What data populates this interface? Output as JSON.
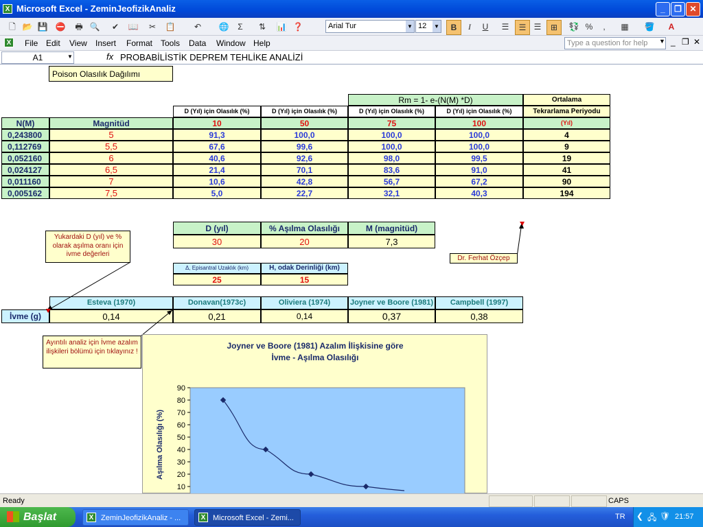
{
  "window": {
    "title": "Microsoft Excel - ZeminJeofizikAnaliz"
  },
  "toolbar": {
    "font": "Arial Tur",
    "font_size": "12"
  },
  "menu": [
    "File",
    "Edit",
    "View",
    "Insert",
    "Format",
    "Tools",
    "Data",
    "Window",
    "Help"
  ],
  "help_placeholder": "Type a question for help",
  "formula_bar": {
    "cell": "A1",
    "fx": "fx",
    "content": "PROBABİLİSTİK DEPREM TEHLİKE ANALİZİ"
  },
  "sheet": {
    "poisson_label": "Poison Olasılık Dağılımı",
    "formula_label": "Rm = 1- e-(N(M) *D)",
    "ortalama_label": "Ortalama",
    "tekrar_label": "Tekrarlama Periyodu",
    "col_headers": [
      "D (Yıl) için Olasılık (%)",
      "D (Yıl) için Olasılık (%)",
      "D (Yıl) için Olasılık (%)",
      "D (Yıl) için Olasılık (%)"
    ],
    "nm_label": "N(M)",
    "mag_label": "Magnitüd",
    "years": [
      "10",
      "50",
      "75",
      "100"
    ],
    "yil_label": "(Yıl)",
    "rows": [
      {
        "nm": "0,243800",
        "mag": "5",
        "p": [
          "91,3",
          "100,0",
          "100,0",
          "100,0"
        ],
        "period": "4"
      },
      {
        "nm": "0,112769",
        "mag": "5,5",
        "p": [
          "67,6",
          "99,6",
          "100,0",
          "100,0"
        ],
        "period": "9"
      },
      {
        "nm": "0,052160",
        "mag": "6",
        "p": [
          "40,6",
          "92,6",
          "98,0",
          "99,5"
        ],
        "period": "19"
      },
      {
        "nm": "0,024127",
        "mag": "6,5",
        "p": [
          "21,4",
          "70,1",
          "83,6",
          "91,0"
        ],
        "period": "41"
      },
      {
        "nm": "0,011160",
        "mag": "7",
        "p": [
          "10,6",
          "42,8",
          "56,7",
          "67,2"
        ],
        "period": "90"
      },
      {
        "nm": "0,005162",
        "mag": "7,5",
        "p": [
          "5,0",
          "22,7",
          "32,1",
          "40,3"
        ],
        "period": "194"
      }
    ],
    "input_headers": [
      "D (yıl)",
      "% Aşılma Olasılığı",
      "M (magnitüd)"
    ],
    "input_values": [
      "30",
      "20",
      "7,3"
    ],
    "dist_headers": [
      "Δ, Episantral Uzaklık (km)",
      "H, odak Derinliği (km)"
    ],
    "dist_values": [
      "25",
      "15"
    ],
    "model_headers": [
      "Esteva (1970)",
      "Donavan(1973c)",
      "Oliviera (1974)",
      "Joyner ve Boore (1981)",
      "Campbell (1997)"
    ],
    "ivme_label": "İvme  (g)",
    "ivme_values": [
      "0,14",
      "0,21",
      "0,14",
      "0,37",
      "0,38"
    ],
    "note1": "Yukardaki D (yıl) ve % olarak aşılma oranı için ivme değerleri",
    "note2": "Ayıntılı analiz için  İvme azalım ilişkileri bölümü için tıklayınız !",
    "note3": "Dr. Ferhat Özçep"
  },
  "chart_data": {
    "type": "line",
    "title": "Joyner ve Boore (1981) Azalım İlişkisine göre",
    "subtitle": "İvme - Aşılma Olasılığı",
    "ylabel": "Aşılma Olasılığı (%)",
    "y_ticks": [
      "90",
      "80",
      "70",
      "60",
      "50",
      "40",
      "30",
      "20",
      "10"
    ],
    "ylim": [
      0,
      90
    ],
    "points": [
      80,
      40,
      20,
      10
    ],
    "grid": false
  },
  "status": {
    "ready": "Ready",
    "caps": "CAPS"
  },
  "taskbar": {
    "start": "Başlat",
    "tasks": [
      "ZeminJeofizikAnaliz - ...",
      "Microsoft Excel - Zemi..."
    ],
    "lang": "TR",
    "time": "21:57"
  }
}
